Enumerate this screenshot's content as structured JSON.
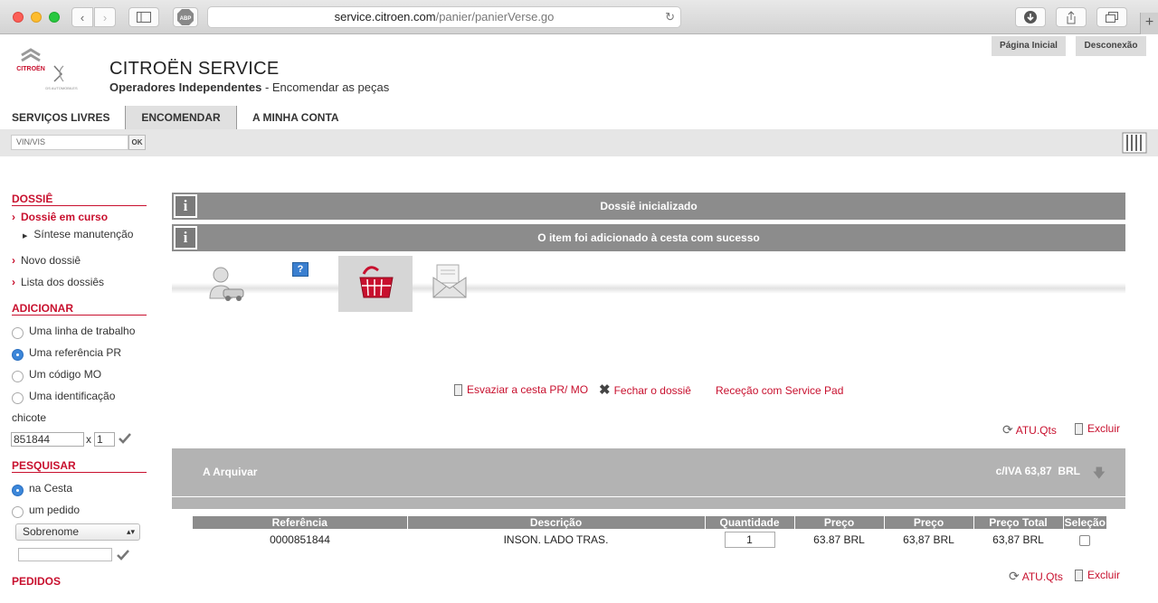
{
  "browser": {
    "url_host": "service.citroen.com",
    "url_path": "/panier/panierVerse.go"
  },
  "header": {
    "top_links": [
      "Página Inicial",
      "Desconexão"
    ],
    "brand_title": "CITROËN SERVICE",
    "brand_sub_bold": "Operadores Independentes",
    "brand_sub_rest": " - Encomendar as peças",
    "logo_citroen": "CITROËN",
    "logo_ds": "DS AUTOMOBILES"
  },
  "nav": {
    "items": [
      "SERVIÇOS LIVRES",
      "ENCOMENDAR",
      "A MINHA CONTA"
    ],
    "active": "ENCOMENDAR"
  },
  "vin": {
    "placeholder": "VIN/VIS",
    "ok": "OK"
  },
  "sidebar": {
    "dossie_title": "DOSSIÊ",
    "dossie_em_curso": "Dossiê em curso",
    "sintese": "Síntese manutenção",
    "novo": "Novo dossiê",
    "lista": "Lista dos dossiês",
    "adicionar_title": "ADICIONAR",
    "add_options": [
      "Uma linha de trabalho",
      "Uma referência PR",
      "Um código MO",
      "Uma identificação"
    ],
    "add_selected": "Uma referência PR",
    "chicote": "chicote",
    "ref_value": "851844",
    "qty_prefix": "x",
    "qty_value": "1",
    "pesquisar_title": "PESQUISAR",
    "search_options": [
      "na Cesta",
      "um pedido"
    ],
    "search_selected": "na Cesta",
    "select_value": "Sobrenome",
    "pedidos_title": "PEDIDOS"
  },
  "messages": [
    "Dossiê inicializado",
    "O item foi adicionado à cesta com sucesso"
  ],
  "actions": {
    "esvaziar": "Esvaziar a cesta PR/ MO",
    "fechar": "Fechar o dossiê",
    "recepcao": "Receção com Service Pad",
    "atu": "ATU.Qts",
    "excluir": "Excluir"
  },
  "basket": {
    "title": "A Arquivar",
    "total": "c/IVA 63,87  BRL"
  },
  "table": {
    "headers": [
      "Referência",
      "Descrição",
      "Quantidade",
      "Preço",
      "Preço",
      "Preço Total",
      "Seleção"
    ],
    "rows": [
      {
        "ref": "0000851844",
        "desc": "INSON. LADO TRAS.",
        "qty": "1",
        "price1": "63.87 BRL",
        "price2": "63,87 BRL",
        "total": "63,87 BRL"
      }
    ]
  }
}
